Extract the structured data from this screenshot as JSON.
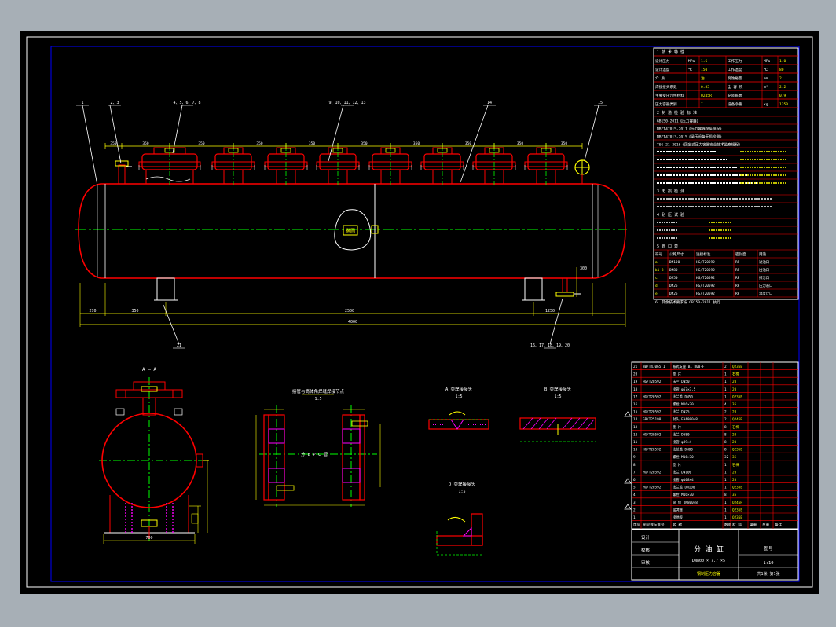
{
  "drawing": {
    "title_label": "分 油 缸",
    "subtitle_label": "DN800 × 7.7  ×5",
    "sheet_label": "钢制压力容器"
  },
  "views": {
    "section_AA_label": "A — A",
    "detail1_label": "接管与筒体角焊缝焊接节点",
    "detail1_scale": "1:5",
    "detail2_label": "A 类焊接接头",
    "detail2_scale": "1:5",
    "detail3_label": "B 类焊接接头",
    "detail3_scale": "1:5",
    "detail4_label": "D 类焊接接头",
    "detail4_scale": "1:5",
    "ellipse_note": "椭圆",
    "center_note": "分 B P C 管"
  },
  "balloons": [
    "1",
    "2、3",
    "4、5、6、7、8",
    "9、10、11、12、13",
    "14",
    "15",
    "21",
    "16、17、18、19、20"
  ],
  "dimensions": {
    "overall_length": "4000",
    "left_offset": "270",
    "support_spacing": "2500",
    "right_offset": "1250",
    "nozzle_pitch": "350",
    "support_height": "300",
    "section_width": "700"
  },
  "colors": {
    "background": "#000000",
    "frame": "#ffffff",
    "inner_frame": "#0000ff",
    "vessel": "#ff0000",
    "centerline": "#00ff00",
    "dims": "#ffff00",
    "text": "#ffffff",
    "leader": "#ffffff",
    "hatch": "#ff00ff"
  },
  "tech_table": {
    "header": "1   技 术 特 性",
    "rows": [
      [
        "设计压力",
        "MPa",
        "1.6",
        "工作压力",
        "MPa",
        "1.0"
      ],
      [
        "设计温度",
        "℃",
        "150",
        "工作温度",
        "℃",
        "80"
      ],
      [
        "介    质",
        "",
        "油",
        "腐蚀裕量",
        "mm",
        "2"
      ],
      [
        "焊接接头系数",
        "",
        "0.85",
        "全 容 积",
        "m³",
        "2.2"
      ],
      [
        "主要受压元件材料",
        "",
        "Q245R",
        "充装系数",
        "",
        "0.9"
      ],
      [
        "压力容器类别",
        "",
        "I",
        "设备净重",
        "kg",
        "1350"
      ]
    ]
  },
  "standards_header": "2  制 造 检 验 标 准",
  "standards_rows": [
    "GB150-2011《压力容器》",
    "NB/T47015-2011《压力容器焊接规程》",
    "NB/T47013-2015《承压设备无损检测》",
    "TSG 21-2016《固定式压力容器安全技术监察规程》"
  ],
  "inspection_header": "3  无 损 检 测",
  "test_header": "4  耐 压 试 验",
  "nozzle_header": "5  管 口 表",
  "nozzle_cols": [
    "符号",
    "公称尺寸",
    "连接标准",
    "密封面",
    "用途"
  ],
  "nozzle_rows": [
    [
      "a",
      "DN100",
      "HG/T20592",
      "RF",
      "进油口"
    ],
    [
      "b1-8",
      "DN80",
      "HG/T20592",
      "RF",
      "出油口"
    ],
    [
      "c",
      "DN50",
      "HG/T20592",
      "RF",
      "排污口"
    ],
    [
      "d",
      "DN25",
      "HG/T20592",
      "RF",
      "压力表口"
    ],
    [
      "e",
      "DN25",
      "HG/T20592",
      "RF",
      "温度计口"
    ]
  ],
  "footnote": "6. 其余技术要求按 GB150-2011 执行",
  "parts_rows": [
    [
      "21",
      "NB/T47065.1",
      "鞍式支座 BI 800-F",
      "2",
      "Q235B",
      "",
      "",
      ""
    ],
    [
      "20",
      "",
      "垫 片",
      "1",
      "石棉",
      "",
      "",
      ""
    ],
    [
      "19",
      "HG/T20592",
      "法兰 DN50",
      "1",
      "20",
      "",
      "",
      ""
    ],
    [
      "18",
      "",
      "接管 φ57×3.5",
      "1",
      "20",
      "",
      "",
      ""
    ],
    [
      "17",
      "HG/T20592",
      "法兰盖 DN50",
      "1",
      "Q235B",
      "",
      "",
      ""
    ],
    [
      "16",
      "",
      "螺栓 M16×70",
      "4",
      "35",
      "",
      "",
      ""
    ],
    [
      "15",
      "HG/T20592",
      "法兰 DN25",
      "2",
      "20",
      "",
      "",
      ""
    ],
    [
      "14",
      "GB/T25198",
      "封头 EHA800×8",
      "2",
      "Q245R",
      "",
      "",
      ""
    ],
    [
      "13",
      "",
      "垫 片",
      "8",
      "石棉",
      "",
      "",
      ""
    ],
    [
      "12",
      "HG/T20592",
      "法兰 DN80",
      "8",
      "20",
      "",
      "",
      ""
    ],
    [
      "11",
      "",
      "接管 φ89×4",
      "8",
      "20",
      "",
      "",
      ""
    ],
    [
      "10",
      "HG/T20592",
      "法兰盖 DN80",
      "8",
      "Q235B",
      "",
      "",
      ""
    ],
    [
      "9",
      "",
      "螺栓 M16×70",
      "32",
      "35",
      "",
      "",
      ""
    ],
    [
      "8",
      "",
      "垫 片",
      "1",
      "石棉",
      "",
      "",
      ""
    ],
    [
      "7",
      "HG/T20592",
      "法兰 DN100",
      "1",
      "20",
      "",
      "",
      ""
    ],
    [
      "6",
      "",
      "接管 φ108×4",
      "1",
      "20",
      "",
      "",
      ""
    ],
    [
      "5",
      "HG/T20592",
      "法兰盖 DN100",
      "1",
      "Q235B",
      "",
      "",
      ""
    ],
    [
      "4",
      "",
      "螺栓 M16×70",
      "8",
      "35",
      "",
      "",
      ""
    ],
    [
      "3",
      "",
      "筒 体 DN800×8",
      "1",
      "Q245R",
      "",
      "",
      ""
    ],
    [
      "2",
      "",
      "铭牌座",
      "1",
      "Q235B",
      "",
      "",
      ""
    ],
    [
      "1",
      "",
      "接地板",
      "1",
      "Q235B",
      "",
      "",
      ""
    ]
  ],
  "parts_header": [
    "序号",
    "图号或标准号",
    "名 称",
    "数量",
    "材 料",
    "单重",
    "总重",
    "备注"
  ],
  "titleblock": {
    "designer": "设计",
    "checker": "校核",
    "approver": "审核",
    "drawing_no": "图号",
    "scale": "1:10",
    "sheet": "共1张 第1张"
  }
}
